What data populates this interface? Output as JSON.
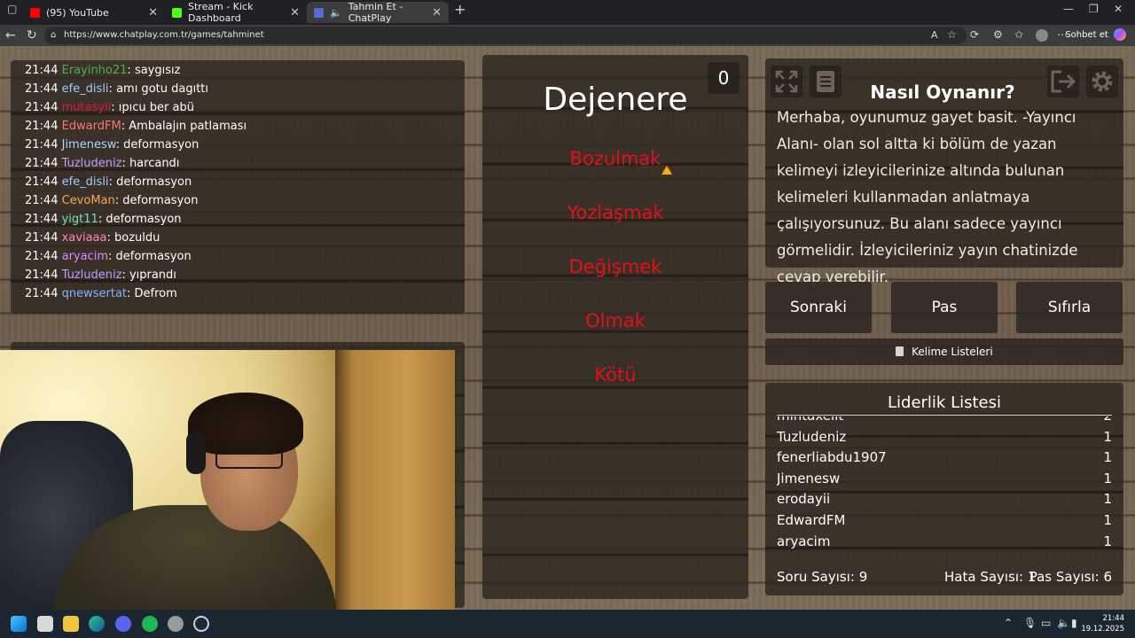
{
  "browser": {
    "tabs": [
      {
        "title": "(95) YouTube",
        "color": "#ff0000",
        "active": false
      },
      {
        "title": "Stream - Kick Dashboard",
        "color": "#53fc18",
        "active": false
      },
      {
        "title": "Tahmin Et - ChatPlay",
        "color": "#5b6bd6",
        "active": true
      }
    ],
    "url": "https://www.chatplay.com.tr/games/tahminet",
    "chat_button": "Sohbet et"
  },
  "chat": {
    "messages": [
      {
        "time": "21:44",
        "user": "Erayinho21",
        "color": "#4caf50",
        "text": "saygısız"
      },
      {
        "time": "21:44",
        "user": "efe_disli",
        "color": "#9ecbff",
        "text": "amı gotu dagıttı"
      },
      {
        "time": "21:44",
        "user": "mutasyii",
        "color": "#e0183a",
        "text": "ıpıcu ber abü"
      },
      {
        "time": "21:44",
        "user": "EdwardFM",
        "color": "#ff7373",
        "text": "Ambalajın patlaması"
      },
      {
        "time": "21:44",
        "user": "Jimenesw",
        "color": "#b0d4ff",
        "text": "deformasyon"
      },
      {
        "time": "21:44",
        "user": "Tuzludeniz",
        "color": "#c39bff",
        "text": "harcandı"
      },
      {
        "time": "21:44",
        "user": "efe_disli",
        "color": "#9ecbff",
        "text": "deformasyon"
      },
      {
        "time": "21:44",
        "user": "CevoMan",
        "color": "#ffa64d",
        "text": "deformasyon"
      },
      {
        "time": "21:44",
        "user": "yigt11",
        "color": "#6fe3b4",
        "text": "deformasyon"
      },
      {
        "time": "21:44",
        "user": "xaviaaa",
        "color": "#ff8ac2",
        "text": "bozuldu"
      },
      {
        "time": "21:44",
        "user": "aryacim",
        "color": "#d68bff",
        "text": "deformasyon"
      },
      {
        "time": "21:44",
        "user": "Tuzludeniz",
        "color": "#c39bff",
        "text": "yıprandı"
      },
      {
        "time": "21:44",
        "user": "qnewsertat",
        "color": "#7fb6ff",
        "text": "Defrom"
      }
    ]
  },
  "game": {
    "score": "0",
    "main_word": "Dejenere",
    "banned_words": [
      "Bozulmak",
      "Yozlaşmak",
      "Değişmek",
      "Olmak",
      "Kötü"
    ],
    "how_to_title": "Nasıl Oynanır?",
    "how_to_text": "Merhaba, oyunumuz gayet basit. -Yayıncı Alanı- olan sol altta ki bölüm de yazan kelimeyi izleyicilerinize altında bulunan kelimeleri kullanmadan anlatmaya çalışıyorsunuz. Bu alanı sadece yayıncı görmelidir. İzleyicileriniz yayın chatinizde cevap verebilir.",
    "buttons": {
      "next": "Sonraki",
      "pass": "Pas",
      "reset": "Sıfırla"
    },
    "word_lists": "Kelime Listeleri",
    "leaderboard": {
      "title": "Liderlik Listesi",
      "rows": [
        {
          "name": "mintaxelit",
          "score": "2"
        },
        {
          "name": "Tuzludeniz",
          "score": "1"
        },
        {
          "name": "fenerliabdu1907",
          "score": "1"
        },
        {
          "name": "Jimenesw",
          "score": "1"
        },
        {
          "name": "erodayii",
          "score": "1"
        },
        {
          "name": "EdwardFM",
          "score": "1"
        },
        {
          "name": "aryacim",
          "score": "1"
        }
      ]
    },
    "stats": {
      "questions": "Soru Sayısı: 9",
      "errors": "Hata Sayısı: 1",
      "passes": "Pas Sayısı: 6"
    }
  },
  "taskbar": {
    "time": "21:44",
    "date": "19.12.2025"
  }
}
